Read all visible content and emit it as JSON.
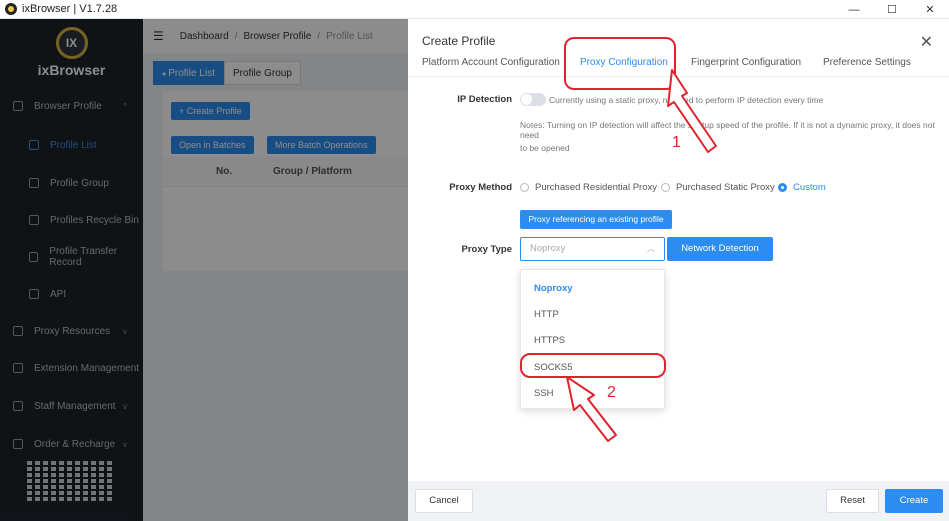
{
  "window": {
    "title": "ixBrowser | V1.7.28",
    "controls": [
      "—",
      "☐",
      "✕"
    ]
  },
  "sidebar": {
    "logo_mark": "IX",
    "logo_name": "ixBrowser",
    "items": [
      {
        "label": "Browser Profile",
        "icon": "monitor-icon",
        "chevron": "^"
      },
      {
        "label": "Profile List",
        "icon": "list-icon"
      },
      {
        "label": "Profile Group",
        "icon": "layers-icon"
      },
      {
        "label": "Profiles Recycle Bin",
        "icon": "trash-icon"
      },
      {
        "label": "Profile Transfer Record",
        "icon": "transfer-icon"
      },
      {
        "label": "API",
        "icon": "api-icon"
      },
      {
        "label": "Proxy Resources",
        "icon": "globe-icon",
        "chevron": "v"
      },
      {
        "label": "Extension Management",
        "icon": "puzzle-icon"
      },
      {
        "label": "Staff Management",
        "icon": "users-icon",
        "chevron": "v"
      },
      {
        "label": "Order & Recharge",
        "icon": "coin-icon",
        "chevron": "v"
      }
    ]
  },
  "topbar": {
    "breadcrumb": [
      "Dashboard",
      "Browser Profile",
      "Profile List"
    ],
    "separator": "/"
  },
  "page_tabs": [
    "Profile List",
    "Profile Group"
  ],
  "toolbar": {
    "create_label": "+ Create Profile",
    "open_batches_label": "Open in Batches",
    "batch_ops_label": "More Batch Operations"
  },
  "table": {
    "columns": [
      "No.",
      "Group / Platform"
    ]
  },
  "drawer": {
    "title": "Create Profile",
    "close": "✕",
    "tabs": [
      "Platform Account Configuration",
      "Proxy Configuration",
      "Fingerprint Configuration",
      "Preference Settings"
    ],
    "active_tab": "Proxy Configuration",
    "ip_detection": {
      "label": "IP Detection",
      "status_text": "Currently using a static proxy, no need to perform IP detection every time",
      "note_line1": "Notes: Turning on IP detection will affect the startup speed of the profile. If it is not a dynamic proxy, it does not need",
      "note_line2": "to be opened"
    },
    "proxy_method": {
      "label": "Proxy Method",
      "options": [
        "Purchased Residential Proxy",
        "Purchased Static Proxy",
        "Custom"
      ],
      "selected": "Custom"
    },
    "reference_button": "Proxy referencing an existing profile",
    "proxy_type": {
      "label": "Proxy Type",
      "value": "Noproxy",
      "options": [
        "Noproxy",
        "HTTP",
        "HTTPS",
        "SOCKS5",
        "SSH"
      ]
    },
    "network_detection": "Network Detection",
    "footer": {
      "cancel": "Cancel",
      "reset": "Reset",
      "create": "Create"
    }
  },
  "annotations": {
    "step1": "1",
    "step2": "2",
    "color": "#e0242e"
  },
  "colors": {
    "accent": "#2d8cf0",
    "sidebar_bg": "#1e2329"
  }
}
